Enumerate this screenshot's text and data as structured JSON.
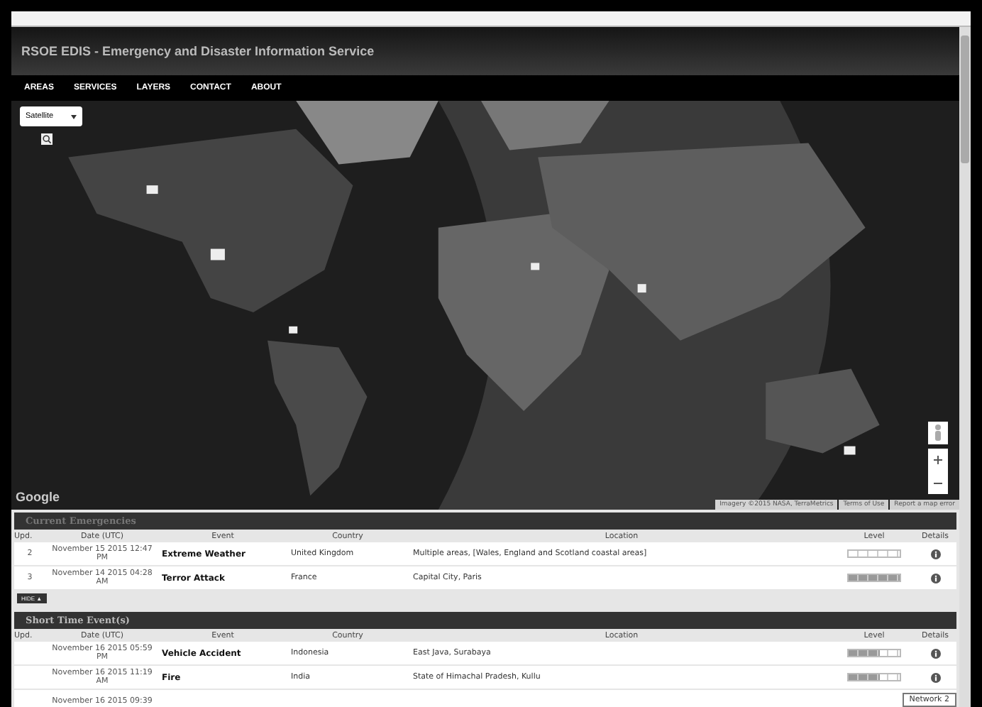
{
  "header": {
    "title": "RSOE EDIS - Emergency and Disaster Information Service"
  },
  "nav": [
    {
      "label": "AREAS"
    },
    {
      "label": "SERVICES"
    },
    {
      "label": "LAYERS"
    },
    {
      "label": "CONTACT"
    },
    {
      "label": "ABOUT"
    }
  ],
  "map": {
    "map_type": "Satellite",
    "logo": "Google",
    "attribution": [
      "Imagery ©2015 NASA, TerraMetrics",
      "Terms of Use",
      "Report a map error"
    ]
  },
  "sections": [
    {
      "title": "Current Emergencies",
      "columns": [
        "Upd.",
        "Date (UTC)",
        "Event",
        "Country",
        "Location",
        "Level",
        "Details"
      ],
      "rows": [
        {
          "upd": "2",
          "date": "November 15 2015 12:47 PM",
          "event": "Extreme Weather",
          "country": "United Kingdom",
          "location": "Multiple areas, [Wales, England and Scotland coastal areas]",
          "level": 0
        },
        {
          "upd": "3",
          "date": "November 14 2015 04:28 AM",
          "event": "Terror Attack",
          "country": "France",
          "location": "Capital City, Paris",
          "level": 1
        }
      ],
      "toggle": "HIDE ▲"
    },
    {
      "title": "Short Time Event(s)",
      "columns": [
        "Upd.",
        "Date (UTC)",
        "Event",
        "Country",
        "Location",
        "Level",
        "Details"
      ],
      "rows": [
        {
          "date": "November 16 2015 05:59 PM",
          "event": "Vehicle Accident",
          "country": "Indonesia",
          "location": "East Java, Surabaya",
          "level": 0.6
        },
        {
          "date": "November 16 2015 11:19 AM",
          "event": "Fire",
          "country": "India",
          "location": "State of Himachal Pradesh, Kullu",
          "level": 0.6
        }
      ],
      "partial_row": {
        "date": "November 16 2015 09:39"
      }
    }
  ],
  "tooltip": "Network 2"
}
